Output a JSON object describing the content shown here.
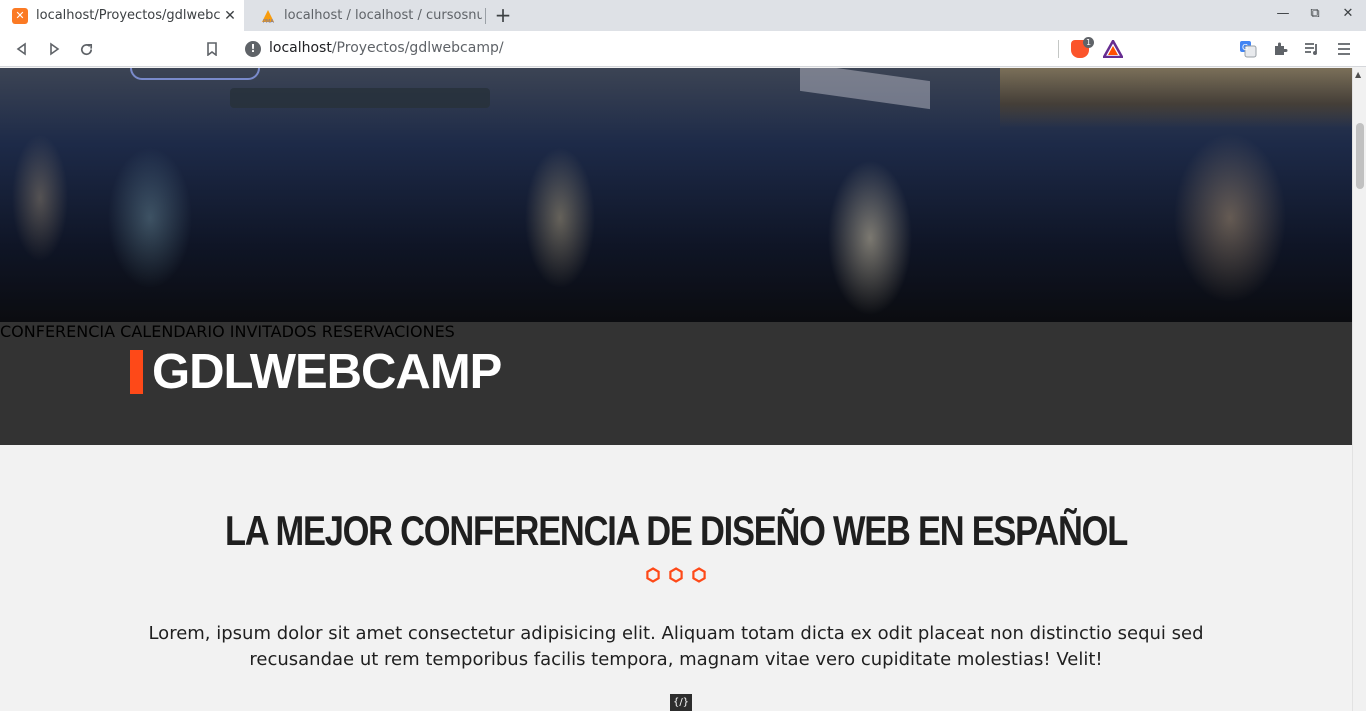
{
  "browser": {
    "tabs": [
      {
        "title": "localhost/Proyectos/gdlwebc",
        "favicon": "xampp-icon",
        "active": true
      },
      {
        "title": "localhost / localhost / cursosnu",
        "favicon": "phpmyadmin-icon",
        "active": false
      }
    ],
    "address": {
      "host": "localhost",
      "path": "/Proyectos/gdlwebcamp/"
    },
    "shields_badge": "1"
  },
  "site": {
    "logo": "GDLWEBCAMP",
    "nav": [
      {
        "label": "CONFERENCIA"
      },
      {
        "label": "CALENDARIO"
      },
      {
        "label": "INVITADOS"
      },
      {
        "label": "RESERVACIONES",
        "active": true
      }
    ],
    "headline": "LA MEJOR CONFERENCIA DE DISEÑO WEB EN ESPAÑOL",
    "intro": "Lorem, ipsum dolor sit amet consectetur adipisicing elit. Aliquam totam dicta ex odit placeat non distinctio sequi sed recusandae ut rem temporibus facilis tempora, magnam vitae vero cupiditate molestias! Velit!",
    "accent_color": "#fe4918",
    "header_color": "#333333"
  }
}
